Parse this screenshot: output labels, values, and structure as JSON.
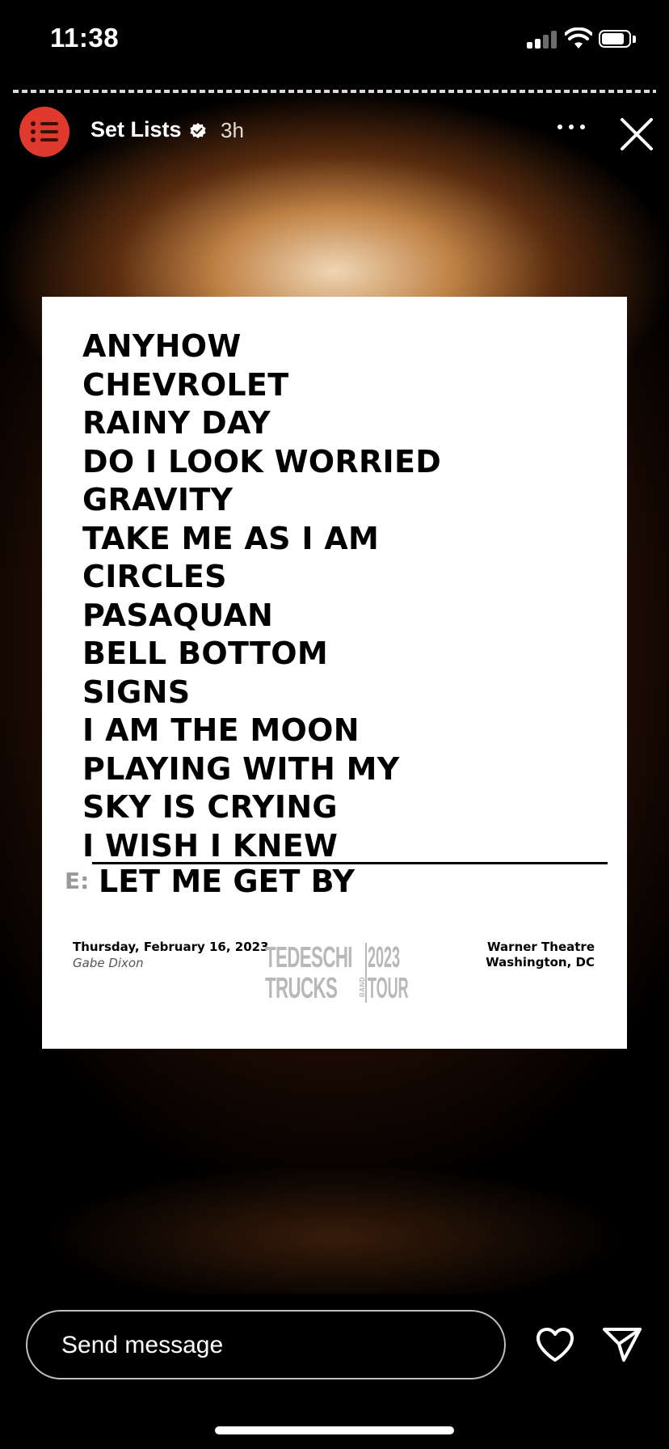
{
  "status_bar": {
    "time": "11:38",
    "icons": [
      "cellular-signal-icon",
      "wifi-icon",
      "battery-icon"
    ]
  },
  "story": {
    "account_name": "Set Lists",
    "verified": true,
    "time_ago": "3h",
    "avatar_icon": "list-icon",
    "menu_icon": "more-icon",
    "close_icon": "close-icon"
  },
  "setlist": {
    "songs": [
      "ANYHOW",
      "CHEVROLET",
      "RAINY DAY",
      "DO I LOOK WORRIED",
      "GRAVITY",
      "TAKE ME AS I AM",
      "CIRCLES",
      "PASAQUAN",
      "BELL BOTTOM",
      "SIGNS",
      "I AM THE MOON",
      "PLAYING WITH MY",
      "SKY IS CRYING",
      "I WISH I KNEW"
    ],
    "encore_label": "E:",
    "encore_song": "LET ME GET BY",
    "date": "Thursday, February 16, 2023",
    "opener": "Gabe Dixon",
    "venue_line1": "Warner Theatre",
    "venue_line2": "Washington, DC",
    "logo": {
      "line1": "TEDESCHI",
      "line2": "TRUCKS",
      "band": "BAND",
      "year": "2023",
      "tour": "TOUR"
    }
  },
  "reply_bar": {
    "placeholder": "Send message",
    "like_icon": "heart-icon",
    "share_icon": "send-icon"
  },
  "colors": {
    "avatar_red": "#e03a2e",
    "logo_gray": "#b8b8b8"
  }
}
